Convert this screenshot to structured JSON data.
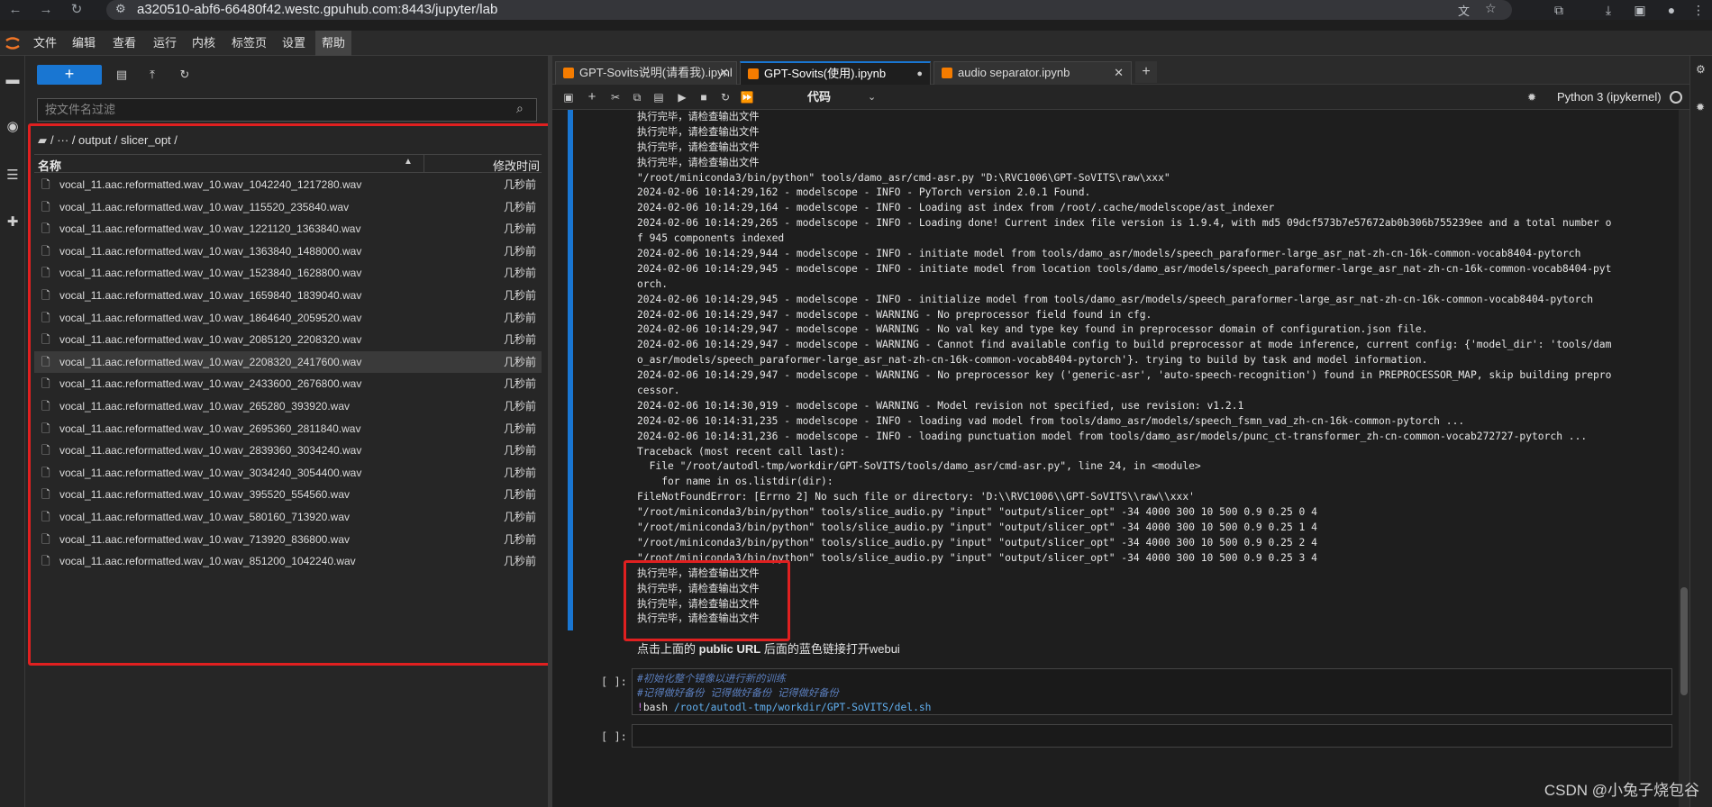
{
  "browser": {
    "url": "a320510-abf6-66480f42.westc.gpuhub.com:8443/jupyter/lab"
  },
  "menubar": {
    "items": [
      "文件",
      "编辑",
      "查看",
      "运行",
      "内核",
      "标签页",
      "设置",
      "帮助"
    ]
  },
  "filebrowser": {
    "new_label": "+",
    "filter_placeholder": "按文件名过滤",
    "breadcrumb": "/  ···  / output / slicer_opt /",
    "col_name": "名称",
    "col_modified": "修改时间",
    "files": [
      {
        "name": "vocal_11.aac.reformatted.wav_10.wav_1042240_1217280.wav",
        "time": "几秒前"
      },
      {
        "name": "vocal_11.aac.reformatted.wav_10.wav_115520_235840.wav",
        "time": "几秒前"
      },
      {
        "name": "vocal_11.aac.reformatted.wav_10.wav_1221120_1363840.wav",
        "time": "几秒前"
      },
      {
        "name": "vocal_11.aac.reformatted.wav_10.wav_1363840_1488000.wav",
        "time": "几秒前"
      },
      {
        "name": "vocal_11.aac.reformatted.wav_10.wav_1523840_1628800.wav",
        "time": "几秒前"
      },
      {
        "name": "vocal_11.aac.reformatted.wav_10.wav_1659840_1839040.wav",
        "time": "几秒前"
      },
      {
        "name": "vocal_11.aac.reformatted.wav_10.wav_1864640_2059520.wav",
        "time": "几秒前"
      },
      {
        "name": "vocal_11.aac.reformatted.wav_10.wav_2085120_2208320.wav",
        "time": "几秒前"
      },
      {
        "name": "vocal_11.aac.reformatted.wav_10.wav_2208320_2417600.wav",
        "time": "几秒前"
      },
      {
        "name": "vocal_11.aac.reformatted.wav_10.wav_2433600_2676800.wav",
        "time": "几秒前"
      },
      {
        "name": "vocal_11.aac.reformatted.wav_10.wav_265280_393920.wav",
        "time": "几秒前"
      },
      {
        "name": "vocal_11.aac.reformatted.wav_10.wav_2695360_2811840.wav",
        "time": "几秒前"
      },
      {
        "name": "vocal_11.aac.reformatted.wav_10.wav_2839360_3034240.wav",
        "time": "几秒前"
      },
      {
        "name": "vocal_11.aac.reformatted.wav_10.wav_3034240_3054400.wav",
        "time": "几秒前"
      },
      {
        "name": "vocal_11.aac.reformatted.wav_10.wav_395520_554560.wav",
        "time": "几秒前"
      },
      {
        "name": "vocal_11.aac.reformatted.wav_10.wav_580160_713920.wav",
        "time": "几秒前"
      },
      {
        "name": "vocal_11.aac.reformatted.wav_10.wav_713920_836800.wav",
        "time": "几秒前"
      },
      {
        "name": "vocal_11.aac.reformatted.wav_10.wav_851200_1042240.wav",
        "time": "几秒前"
      }
    ]
  },
  "tabs": [
    {
      "label": "GPT-Sovits说明(请看我).ipynl"
    },
    {
      "label": "GPT-Sovits(使用).ipynb"
    },
    {
      "label": "audio separator.ipynb"
    }
  ],
  "toolbar": {
    "cell_type": "代码",
    "kernel": "Python 3 (ipykernel)"
  },
  "output_lines": [
    "执行完毕，请检查输出文件",
    "执行完毕，请检查输出文件",
    "执行完毕，请检查输出文件",
    "执行完毕，请检查输出文件",
    "\"/root/miniconda3/bin/python\" tools/damo_asr/cmd-asr.py \"D:\\RVC1006\\GPT-SoVITS\\raw\\xxx\"",
    "2024-02-06 10:14:29,162 - modelscope - INFO - PyTorch version 2.0.1 Found.",
    "2024-02-06 10:14:29,164 - modelscope - INFO - Loading ast index from /root/.cache/modelscope/ast_indexer",
    "2024-02-06 10:14:29,265 - modelscope - INFO - Loading done! Current index file version is 1.9.4, with md5 09dcf573b7e57672ab0b306b755239ee and a total number o",
    "f 945 components indexed",
    "2024-02-06 10:14:29,944 - modelscope - INFO - initiate model from tools/damo_asr/models/speech_paraformer-large_asr_nat-zh-cn-16k-common-vocab8404-pytorch",
    "2024-02-06 10:14:29,945 - modelscope - INFO - initiate model from location tools/damo_asr/models/speech_paraformer-large_asr_nat-zh-cn-16k-common-vocab8404-pyt",
    "orch.",
    "2024-02-06 10:14:29,945 - modelscope - INFO - initialize model from tools/damo_asr/models/speech_paraformer-large_asr_nat-zh-cn-16k-common-vocab8404-pytorch",
    "2024-02-06 10:14:29,947 - modelscope - WARNING - No preprocessor field found in cfg.",
    "2024-02-06 10:14:29,947 - modelscope - WARNING - No val key and type key found in preprocessor domain of configuration.json file.",
    "2024-02-06 10:14:29,947 - modelscope - WARNING - Cannot find available config to build preprocessor at mode inference, current config: {'model_dir': 'tools/dam",
    "o_asr/models/speech_paraformer-large_asr_nat-zh-cn-16k-common-vocab8404-pytorch'}. trying to build by task and model information.",
    "2024-02-06 10:14:29,947 - modelscope - WARNING - No preprocessor key ('generic-asr', 'auto-speech-recognition') found in PREPROCESSOR_MAP, skip building prepro",
    "cessor.",
    "2024-02-06 10:14:30,919 - modelscope - WARNING - Model revision not specified, use revision: v1.2.1",
    "2024-02-06 10:14:31,235 - modelscope - INFO - loading vad model from tools/damo_asr/models/speech_fsmn_vad_zh-cn-16k-common-pytorch ...",
    "2024-02-06 10:14:31,236 - modelscope - INFO - loading punctuation model from tools/damo_asr/models/punc_ct-transformer_zh-cn-common-vocab272727-pytorch ...",
    "Traceback (most recent call last):",
    "  File \"/root/autodl-tmp/workdir/GPT-SoVITS/tools/damo_asr/cmd-asr.py\", line 24, in <module>",
    "    for name in os.listdir(dir):",
    "FileNotFoundError: [Errno 2] No such file or directory: 'D:\\\\RVC1006\\\\GPT-SoVITS\\\\raw\\\\xxx'",
    "\"/root/miniconda3/bin/python\" tools/slice_audio.py \"input\" \"output/slicer_opt\" -34 4000 300 10 500 0.9 0.25 0 4",
    "\"/root/miniconda3/bin/python\" tools/slice_audio.py \"input\" \"output/slicer_opt\" -34 4000 300 10 500 0.9 0.25 1 4",
    "\"/root/miniconda3/bin/python\" tools/slice_audio.py \"input\" \"output/slicer_opt\" -34 4000 300 10 500 0.9 0.25 2 4",
    "\"/root/miniconda3/bin/python\" tools/slice_audio.py \"input\" \"output/slicer_opt\" -34 4000 300 10 500 0.9 0.25 3 4",
    "执行完毕，请检查输出文件",
    "执行完毕，请检查输出文件",
    "执行完毕，请检查输出文件",
    "执行完毕，请检查输出文件"
  ],
  "markdown": {
    "prefix": "点击上面的 ",
    "bold": "public URL",
    "suffix": " 后面的蓝色链接打开webui"
  },
  "cell1": {
    "prompt": "[ ]:",
    "comment1": "#初始化整个镜像以进行新的训练",
    "comment2": "#记得做好备份 记得做好备份 记得做好备份",
    "bang": "!",
    "cmd": "bash ",
    "path": "/root/autodl-tmp/workdir/GPT-SoVITS/del.sh"
  },
  "cell2": {
    "prompt": "[ ]:"
  },
  "watermark": "CSDN @小兔子烧包谷"
}
